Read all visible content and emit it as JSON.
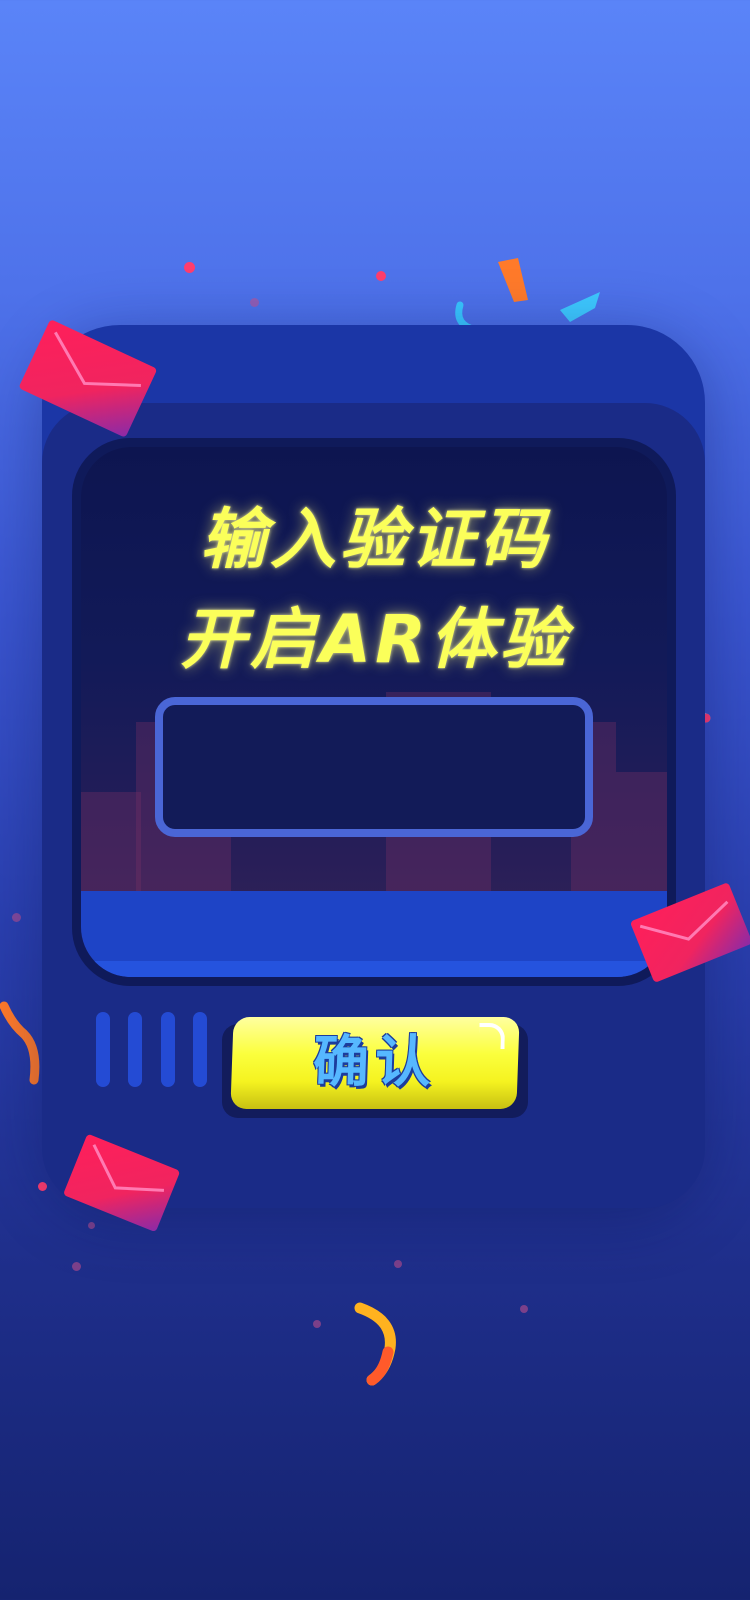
{
  "heading": {
    "line1": "输入验证码",
    "line2": "开启AR体验"
  },
  "code_input": {
    "value": "",
    "placeholder": ""
  },
  "confirm_button": {
    "label": "确认"
  },
  "colors": {
    "background_top": "#5a84f8",
    "background_bottom": "#152370",
    "machine": "#1a2b87",
    "title_text": "#fbff5a",
    "button_fill": "#fbff3d",
    "button_text": "#56b8ff",
    "input_border": "#4a66d6"
  },
  "decorations": {
    "envelope_icons": 4,
    "confetti": "confetti-icon"
  }
}
